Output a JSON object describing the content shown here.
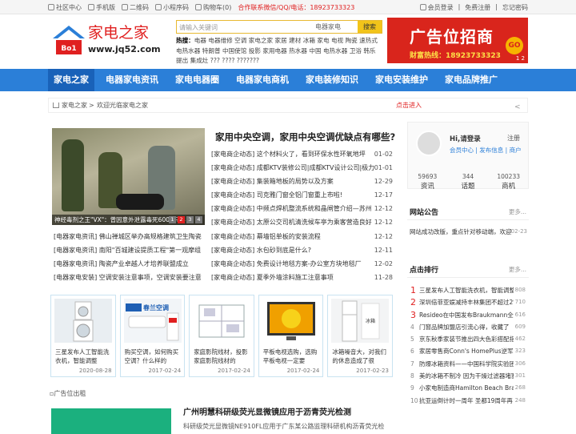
{
  "topbar": {
    "left": [
      "社区中心",
      "手机版",
      "二维码",
      "小程序码",
      "购物车(0)"
    ],
    "contact": "合作联系微信/QQ/电话：18923733323",
    "right": [
      "会员登录",
      "免费注册",
      "忘记密码"
    ]
  },
  "logo": {
    "title": "家电之家",
    "url": "www.jq52.com",
    "badge": "Bo1"
  },
  "search": {
    "placeholder": "请输入关键词",
    "category": "电器家电",
    "button": "搜索",
    "hot_label": "热搜：",
    "hot_words": "电器 电器维修 空调 家电之家 家居 建材 冰箱 家电 电视 陶瓷 速热式电热水器 特朗普 中国使馆 投影 家用电器 热水器 中国 电热水器 卫浴 韩乐 提出 集成灶 ??? ???? ???????"
  },
  "ad": {
    "big": "广告位招商",
    "tel": "财富热线：18923733323",
    "go": "GO",
    "pager": "1 2"
  },
  "nav": [
    "家电之家",
    "电器家电资讯",
    "家电电器圈",
    "电器家电商机",
    "家电装修知识",
    "家电安装维护",
    "家电品牌推广"
  ],
  "breadcrumb": {
    "home": "家电之家",
    "sep": ">",
    "current": "欢迎光临家电之家",
    "enter": "点击进入"
  },
  "slide": {
    "caption": "神经毒剂之王\"VX\"：曾因意外泄露毒死6000只羊",
    "dots": [
      "1",
      "2",
      "3",
      "4"
    ]
  },
  "headline": "家用中央空调，家用中央空调优缺点有哪些?",
  "news": [
    {
      "t": "[家电商企动态] 这个材料火了，看到环保水性环氧地坪",
      "d": "01-02"
    },
    {
      "t": "[家电商企动态] 成都KTV装修公司|成都KTV设计公司|极力",
      "d": "01-01"
    },
    {
      "t": "[家电商企动态] 集装箱地板的局势以及方案",
      "d": "12-29"
    },
    {
      "t": "[家电商企动态] 司克雅门窗全铝门窗重上市啦!",
      "d": "12-17"
    },
    {
      "t": "[家电商企动态] 中频点焊机整流系统和晶闸管介绍—苏州",
      "d": "12-12"
    },
    {
      "t": "[家电商企动态] 太原公交司机清洗候车亭为乘客营造良好",
      "d": "12-12"
    },
    {
      "t": "[家电商企动态] 幕墙铝单板的安装流程",
      "d": "12-12"
    },
    {
      "t": "[家电商企动态] 水包砂到底是什么?",
      "d": "12-11"
    },
    {
      "t": "[家电商企动态] 免费设计地毯方案-办公室方块地毯厂",
      "d": "12-02"
    },
    {
      "t": "[家电商企动态] 夏季外墙涂料施工注意事项",
      "d": "11-28"
    }
  ],
  "left_news": [
    "[电器家电资讯] 佛山禅城区举办高规格建筑卫生陶瓷",
    "[电器家电资讯] 南阳\"百城建设提质工程\"第一观摩组",
    "[电器家电资讯] 陶瓷产业卓越人才培养联盟成立",
    "[电器家电安装] 空调安装注意事项，空调安装要注意"
  ],
  "cards": [
    {
      "title": "三星发布人工智能洗衣机，智能调整",
      "date": "2020-08-28"
    },
    {
      "title": "购买空调，如何购买空调？什么样的",
      "date": "2017-02-24"
    },
    {
      "title": "家庭影院线材，投影家庭影院线材的",
      "date": "2017-02-24"
    },
    {
      "title": "平板电视选购，选购平板电视一定要",
      "date": "2017-02-24"
    },
    {
      "title": "冰箱噪音大，对我们的休息造成了很",
      "date": "2017-02-23"
    }
  ],
  "ad_bottom": "广告位出租",
  "feature": {
    "title": "广州明慧科研级荧光显微镜应用于沥青荧光检测",
    "desc": "科研级荧光显微镜NE910FL应用于广东某公路监理科研机构沥青荧光检"
  },
  "user": {
    "hi": "Hi,请登录",
    "register": "注册",
    "links": "会员中心 | 发布信息 | 商户"
  },
  "stats": [
    {
      "n": "59693",
      "l": "资讯"
    },
    {
      "n": "344",
      "l": "话题"
    },
    {
      "n": "100233",
      "l": "商机"
    }
  ],
  "notice": {
    "title": "网站公告",
    "more": "更多...",
    "text": "网站成功改版，重点针对移动端，欢迎",
    "date": "02-23"
  },
  "rank": {
    "title": "点击排行",
    "more": "更多...",
    "items": [
      {
        "n": "1",
        "t": "三星发布人工智能洗衣机，智能调整",
        "c": "808"
      },
      {
        "n": "2",
        "t": "深圳倍菲亚娱减持丰林集团不超过2%",
        "c": "710"
      },
      {
        "n": "3",
        "t": "Resideo在中国发布Braukmann全屋净",
        "c": "616"
      },
      {
        "n": "4",
        "t": "门窗品牌加盟店引流心得，收藏了",
        "c": "609"
      },
      {
        "n": "5",
        "t": "京东秋季家装节推出四大色彩搭配指",
        "c": "462"
      },
      {
        "n": "6",
        "t": "家居零售商Conn's HomePlus逆军团",
        "c": "323"
      },
      {
        "n": "7",
        "t": "防爆冰箱资料——中国科学院实验团",
        "c": "306"
      },
      {
        "n": "8",
        "t": "美的冰箱不制冷 因为干燥过滤器堵塞",
        "c": "301"
      },
      {
        "n": "9",
        "t": "小家电制造商Hamilton Beach Brands",
        "c": "268"
      },
      {
        "n": "10",
        "t": "抗亚运倒计时一周年 圣都19周年再",
        "c": "248"
      }
    ]
  }
}
